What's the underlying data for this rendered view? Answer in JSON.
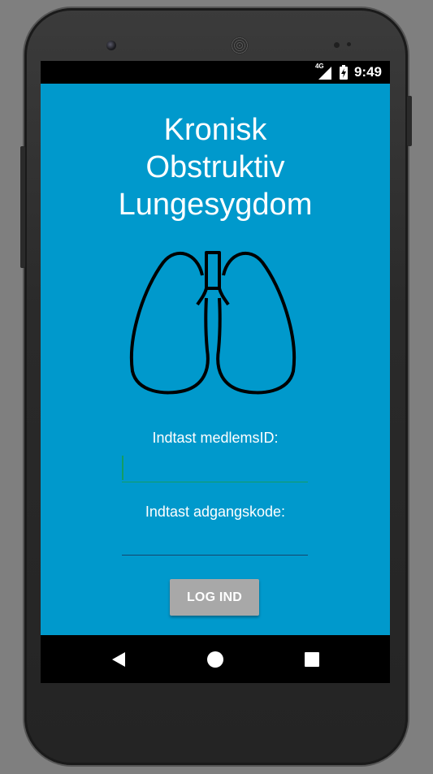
{
  "statusbar": {
    "network": "4G",
    "time": "9:49"
  },
  "app": {
    "title_lines": [
      "Kronisk",
      "Obstruktiv",
      "Lungesygdom"
    ],
    "logo_icon": "lungs-icon",
    "member_id_label": "Indtast medlemsID:",
    "member_id_value": "",
    "password_label": "Indtast adgangskode:",
    "password_value": "",
    "login_button": "LOG IND"
  },
  "navbar": {
    "back": "back-icon",
    "home": "home-icon",
    "recents": "recents-icon"
  },
  "colors": {
    "app_background": "#0099cc",
    "button": "#a8a8a8",
    "active_field_underline": "#129d65",
    "field_underline": "#14466e"
  }
}
